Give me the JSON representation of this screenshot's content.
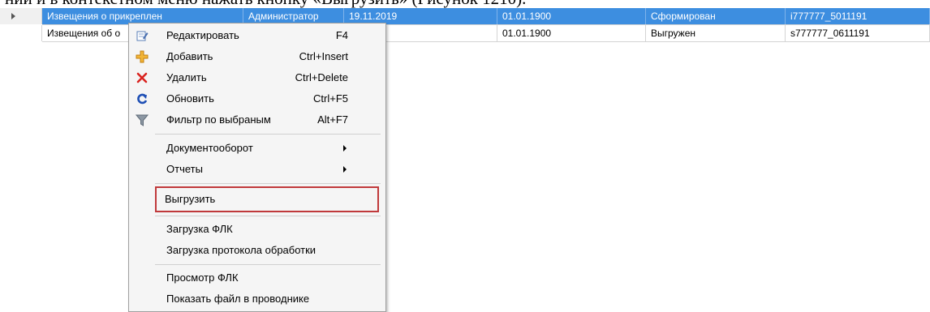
{
  "doc": {
    "caption_line": "ний и в контекстном меню нажать кнопку «Выгрузить» (Рисунок 1210)."
  },
  "grid": {
    "rows": [
      {
        "name": "Извещения о прикреплен",
        "author": "Администратор",
        "date1": "19.11.2019",
        "date2": "01.01.1900",
        "status": "Сформирован",
        "file": "i777777_5011191"
      },
      {
        "name": "Извещения об о",
        "author": "",
        "date1": "2019",
        "date2": "01.01.1900",
        "status": "Выгружен",
        "file": "s777777_0611191"
      }
    ]
  },
  "menu": {
    "items": [
      {
        "label": "Редактировать",
        "shortcut": "F4",
        "icon": "edit-icon"
      },
      {
        "label": "Добавить",
        "shortcut": "Ctrl+Insert",
        "icon": "add-icon"
      },
      {
        "label": "Удалить",
        "shortcut": "Ctrl+Delete",
        "icon": "delete-icon"
      },
      {
        "label": "Обновить",
        "shortcut": "Ctrl+F5",
        "icon": "refresh-icon"
      },
      {
        "label": "Фильтр по выбраным",
        "shortcut": "Alt+F7",
        "icon": "filter-icon"
      },
      {
        "label": "Документооборот",
        "shortcut": "",
        "submenu": true
      },
      {
        "label": "Отчеты",
        "shortcut": "",
        "submenu": true
      },
      {
        "label": "Выгрузить",
        "shortcut": ""
      },
      {
        "label": "Загрузка ФЛК",
        "shortcut": ""
      },
      {
        "label": "Загрузка протокола обработки",
        "shortcut": ""
      },
      {
        "label": "Просмотр ФЛК",
        "shortcut": ""
      },
      {
        "label": "Показать файл в проводнике",
        "shortcut": ""
      }
    ]
  },
  "colors": {
    "selection": "#3d8ee0",
    "highlight_border": "#c0393b",
    "delete_icon": "#d9231f",
    "add_icon": "#e8a317",
    "refresh_icon": "#1e4fb5"
  }
}
